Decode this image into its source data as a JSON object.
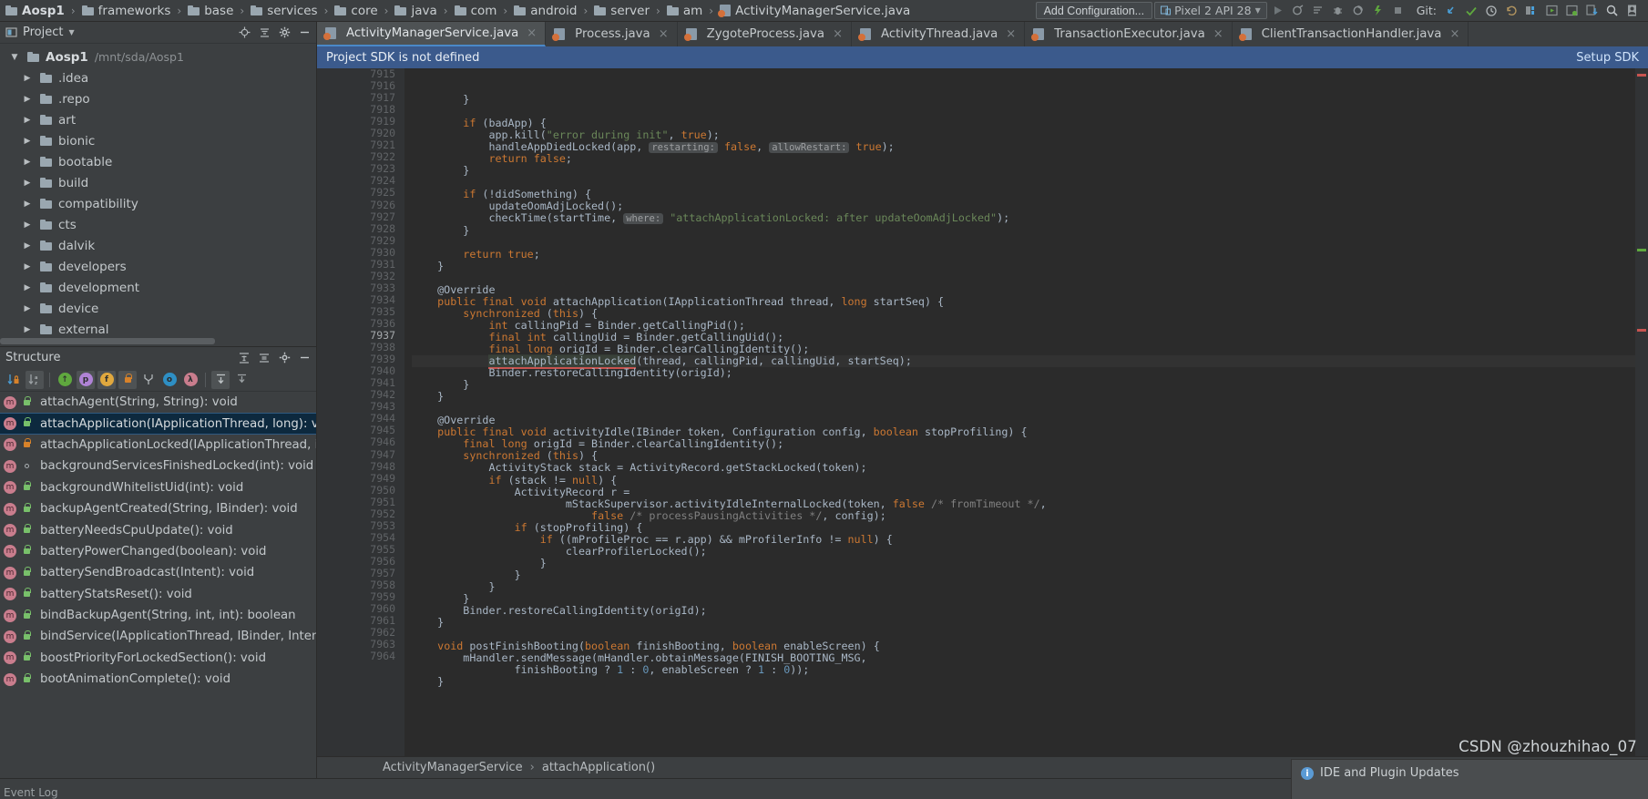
{
  "breadcrumb": {
    "root": "Aosp1",
    "items": [
      "frameworks",
      "base",
      "services",
      "core",
      "java",
      "com",
      "android",
      "server",
      "am"
    ],
    "file": "ActivityManagerService.java"
  },
  "toolbar": {
    "add_configuration": "Add Configuration...",
    "device": "Pixel 2 API 28",
    "git_label": "Git:",
    "icons": [
      "run-icon",
      "debug-attach-icon",
      "stop-gradle-icon",
      "bug-icon",
      "profiler-icon",
      "run-coverage-icon",
      "stop-icon",
      "update-project-icon",
      "commit-icon",
      "history-icon",
      "rollback-icon",
      "avd-manager-icon",
      "sdk-manager-icon",
      "layout-inspector-icon",
      "device-file-explorer-icon",
      "search-everywhere-icon",
      "user-icon"
    ]
  },
  "project_panel": {
    "title": "Project",
    "header_icons": [
      "locate-icon",
      "collapse-all-icon",
      "settings-icon",
      "hide-icon"
    ],
    "tree": [
      {
        "label": "Aosp1",
        "path": "/mnt/sda/Aosp1",
        "expanded": true,
        "root": true
      },
      {
        "label": ".idea",
        "path": "",
        "expanded": false,
        "root": false
      },
      {
        "label": ".repo",
        "path": "",
        "expanded": false,
        "root": false
      },
      {
        "label": "art",
        "path": "",
        "expanded": false,
        "root": false
      },
      {
        "label": "bionic",
        "path": "",
        "expanded": false,
        "root": false
      },
      {
        "label": "bootable",
        "path": "",
        "expanded": false,
        "root": false
      },
      {
        "label": "build",
        "path": "",
        "expanded": false,
        "root": false
      },
      {
        "label": "compatibility",
        "path": "",
        "expanded": false,
        "root": false
      },
      {
        "label": "cts",
        "path": "",
        "expanded": false,
        "root": false
      },
      {
        "label": "dalvik",
        "path": "",
        "expanded": false,
        "root": false
      },
      {
        "label": "developers",
        "path": "",
        "expanded": false,
        "root": false
      },
      {
        "label": "development",
        "path": "",
        "expanded": false,
        "root": false
      },
      {
        "label": "device",
        "path": "",
        "expanded": false,
        "root": false
      },
      {
        "label": "external",
        "path": "",
        "expanded": false,
        "root": false
      }
    ]
  },
  "structure_panel": {
    "title": "Structure",
    "header_icons": [
      "expand-all-icon",
      "collapse-all-icon"
    ],
    "toolbar_icons": [
      "sort-by-visibility-icon",
      "sort-alphabetically-icon",
      "show-inherited-icon",
      "show-properties-icon",
      "show-fields-icon",
      "show-non-public-icon",
      "show-anonymous-icon",
      "show-interfaces-icon",
      "show-lambdas-icon",
      "expand-all-icon",
      "collapse-all-icon"
    ],
    "items": [
      {
        "label": "attachAgent(String, String): void",
        "vis": "public",
        "selected": false
      },
      {
        "label": "attachApplication(IApplicationThread, long): void",
        "vis": "public",
        "selected": true
      },
      {
        "label": "attachApplicationLocked(IApplicationThread, int, int, l",
        "vis": "private",
        "selected": false
      },
      {
        "label": "backgroundServicesFinishedLocked(int): void",
        "vis": "package",
        "selected": false
      },
      {
        "label": "backgroundWhitelistUid(int): void",
        "vis": "public",
        "selected": false
      },
      {
        "label": "backupAgentCreated(String, IBinder): void",
        "vis": "public",
        "selected": false
      },
      {
        "label": "batteryNeedsCpuUpdate(): void",
        "vis": "public",
        "selected": false
      },
      {
        "label": "batteryPowerChanged(boolean): void",
        "vis": "public",
        "selected": false
      },
      {
        "label": "batterySendBroadcast(Intent): void",
        "vis": "public",
        "selected": false
      },
      {
        "label": "batteryStatsReset(): void",
        "vis": "public",
        "selected": false
      },
      {
        "label": "bindBackupAgent(String, int, int): boolean",
        "vis": "public",
        "selected": false
      },
      {
        "label": "bindService(IApplicationThread, IBinder, Intent, String",
        "vis": "public",
        "selected": false
      },
      {
        "label": "boostPriorityForLockedSection(): void",
        "vis": "public",
        "selected": false
      },
      {
        "label": "bootAnimationComplete(): void",
        "vis": "public",
        "selected": false
      }
    ]
  },
  "editor": {
    "tabs": [
      {
        "label": "ActivityManagerService.java",
        "active": true
      },
      {
        "label": "Process.java",
        "active": false
      },
      {
        "label": "ZygoteProcess.java",
        "active": false
      },
      {
        "label": "ActivityThread.java",
        "active": false
      },
      {
        "label": "TransactionExecutor.java",
        "active": false
      },
      {
        "label": "ClientTransactionHandler.java",
        "active": false
      }
    ],
    "notification": {
      "message": "Project SDK is not defined",
      "action": "Setup SDK"
    },
    "first_line_number": 7915,
    "current_line": 7937,
    "breadcrumb": [
      "ActivityManagerService",
      "attachApplication()"
    ],
    "lines": [
      {
        "n": 7915,
        "fold": "end",
        "html": "        }"
      },
      {
        "n": 7916,
        "fold": "",
        "html": ""
      },
      {
        "n": 7917,
        "fold": "start",
        "html": "        <span class=\"kw\">if</span> (badApp) {"
      },
      {
        "n": 7918,
        "fold": "",
        "html": "            app.kill(<span class=\"str\">\"error during init\"</span>, <span class=\"kw\">true</span>);"
      },
      {
        "n": 7919,
        "fold": "",
        "html": "            handleAppDiedLocked(app, <span class=\"hint\">restarting:</span> <span class=\"kw\">false</span>, <span class=\"hint\">allowRestart:</span> <span class=\"kw\">true</span>);"
      },
      {
        "n": 7920,
        "fold": "",
        "html": "            <span class=\"kw\">return false</span>;"
      },
      {
        "n": 7921,
        "fold": "end",
        "html": "        }"
      },
      {
        "n": 7922,
        "fold": "",
        "html": ""
      },
      {
        "n": 7923,
        "fold": "start",
        "html": "        <span class=\"kw\">if</span> (!didSomething) {"
      },
      {
        "n": 7924,
        "fold": "",
        "html": "            updateOomAdjLocked();"
      },
      {
        "n": 7925,
        "fold": "",
        "html": "            checkTime(startTime, <span class=\"hint\">where:</span> <span class=\"str\">\"attachApplicationLocked: after updateOomAdjLocked\"</span>);"
      },
      {
        "n": 7926,
        "fold": "end",
        "html": "        }"
      },
      {
        "n": 7927,
        "fold": "",
        "html": ""
      },
      {
        "n": 7928,
        "fold": "",
        "html": "        <span class=\"kw\">return true</span>;"
      },
      {
        "n": 7929,
        "fold": "end",
        "html": "    }"
      },
      {
        "n": 7930,
        "fold": "",
        "html": ""
      },
      {
        "n": 7931,
        "fold": "",
        "html": "    @Override"
      },
      {
        "n": 7932,
        "fold": "start",
        "html": "    <span class=\"kw\">public final void</span> attachApplication(IApplicationThread thread, <span class=\"kw\">long</span> startSeq) {"
      },
      {
        "n": 7933,
        "fold": "start",
        "html": "        <span class=\"kw\">synchronized</span> (<span class=\"kw\">this</span>) {"
      },
      {
        "n": 7934,
        "fold": "",
        "html": "            <span class=\"kw\">int</span> callingPid = Binder.getCallingPid();"
      },
      {
        "n": 7935,
        "fold": "",
        "html": "            <span class=\"kw\">final int</span> callingUid = Binder.getCallingUid();"
      },
      {
        "n": 7936,
        "fold": "",
        "html": "            <span class=\"kw\">final long</span> origId = Binder.clearCallingIdentity();"
      },
      {
        "n": 7937,
        "fold": "",
        "cur": true,
        "html": "            <span class=\"errl\">attachApplicationLocked</span>(thread, callingPid, callingUid, startSeq);"
      },
      {
        "n": 7938,
        "fold": "",
        "html": "            Binder.restoreCallingIdentity(origId);"
      },
      {
        "n": 7939,
        "fold": "end",
        "html": "        }"
      },
      {
        "n": 7940,
        "fold": "end",
        "html": "    }"
      },
      {
        "n": 7941,
        "fold": "",
        "html": ""
      },
      {
        "n": 7942,
        "fold": "",
        "html": "    @Override"
      },
      {
        "n": 7943,
        "fold": "start",
        "html": "    <span class=\"kw\">public final void</span> activityIdle(IBinder token, Configuration config, <span class=\"kw\">boolean</span> stopProfiling) {"
      },
      {
        "n": 7944,
        "fold": "",
        "html": "        <span class=\"kw\">final long</span> origId = Binder.clearCallingIdentity();"
      },
      {
        "n": 7945,
        "fold": "start",
        "html": "        <span class=\"kw\">synchronized</span> (<span class=\"kw\">this</span>) {"
      },
      {
        "n": 7946,
        "fold": "",
        "html": "            ActivityStack stack = ActivityRecord.getStackLocked(token);"
      },
      {
        "n": 7947,
        "fold": "start",
        "html": "            <span class=\"kw\">if</span> (stack != <span class=\"kw\">null</span>) {"
      },
      {
        "n": 7948,
        "fold": "",
        "html": "                ActivityRecord r ="
      },
      {
        "n": 7949,
        "fold": "",
        "html": "                        mStackSupervisor.activityIdleInternalLocked(token, <span class=\"kw\">false</span> <span class=\"cmt\">/* fromTimeout */</span>,"
      },
      {
        "n": 7950,
        "fold": "",
        "html": "                            <span class=\"kw\">false</span> <span class=\"cmt\">/* processPausingActivities */</span>, config);"
      },
      {
        "n": 7951,
        "fold": "start",
        "html": "                <span class=\"kw\">if</span> (stopProfiling) {"
      },
      {
        "n": 7952,
        "fold": "start",
        "html": "                    <span class=\"kw\">if</span> ((mProfileProc == r.app) &amp;&amp; mProfilerInfo != <span class=\"kw\">null</span>) {"
      },
      {
        "n": 7953,
        "fold": "",
        "html": "                        clearProfilerLocked();"
      },
      {
        "n": 7954,
        "fold": "end",
        "html": "                    }"
      },
      {
        "n": 7955,
        "fold": "end",
        "html": "                }"
      },
      {
        "n": 7956,
        "fold": "end",
        "html": "            }"
      },
      {
        "n": 7957,
        "fold": "end",
        "html": "        }"
      },
      {
        "n": 7958,
        "fold": "",
        "html": "        Binder.restoreCallingIdentity(origId);"
      },
      {
        "n": 7959,
        "fold": "end",
        "html": "    }"
      },
      {
        "n": 7960,
        "fold": "",
        "html": ""
      },
      {
        "n": 7961,
        "fold": "start",
        "html": "    <span class=\"kw\">void</span> postFinishBooting(<span class=\"kw\">boolean</span> finishBooting, <span class=\"kw\">boolean</span> enableScreen) {"
      },
      {
        "n": 7962,
        "fold": "",
        "html": "        mHandler.sendMessage(mHandler.obtainMessage(FINISH_BOOTING_MSG,"
      },
      {
        "n": 7963,
        "fold": "",
        "html": "                finishBooting ? <span class=\"num\">1</span> : <span class=\"num\">0</span>, enableScreen ? <span class=\"num\">1</span> : <span class=\"num\">0</span>));"
      },
      {
        "n": 7964,
        "fold": "end",
        "html": "    }"
      }
    ]
  },
  "status_bar": {
    "event_log": "Event Log",
    "notification_title": "IDE and Plugin Updates",
    "watermark": "CSDN @zhouzhihao_07"
  },
  "colors": {
    "accent_blue": "#4a88c7",
    "sdk_bar": "#3b5a8c",
    "selection": "#0d293e",
    "keyword": "#cc7832",
    "string": "#6a8759",
    "editor_bg": "#2b2b2b",
    "panel_bg": "#3c3f41"
  }
}
